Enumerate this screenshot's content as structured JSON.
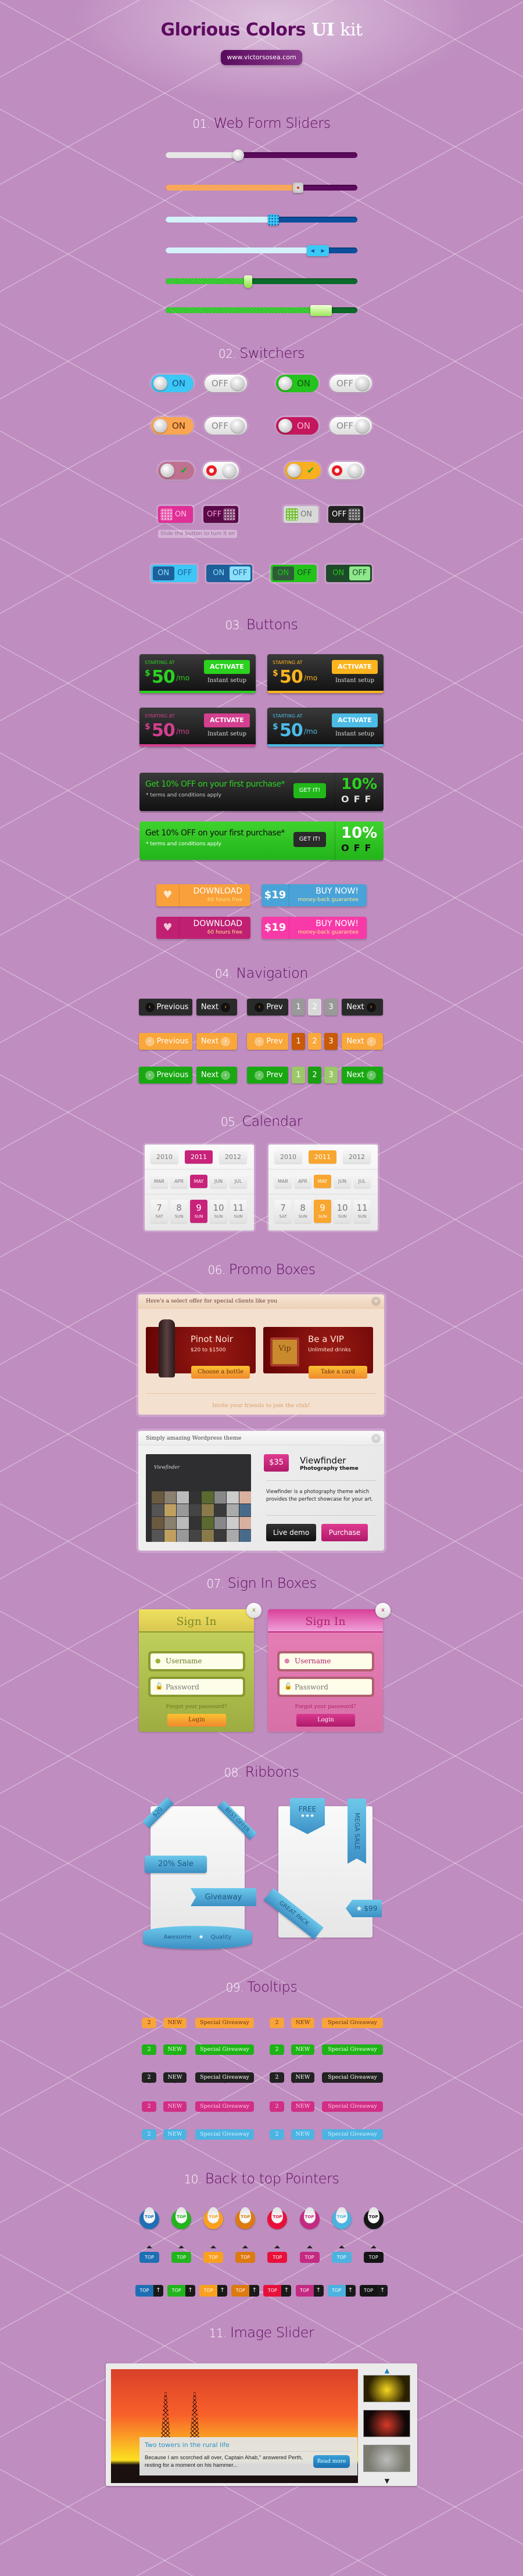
{
  "header": {
    "title_a": "Glorious Colors",
    "title_b": "UI",
    "title_c": "kit",
    "url": "www.victorsosea.com"
  },
  "sections": [
    {
      "num": "01.",
      "title": "Web Form Sliders"
    },
    {
      "num": "02.",
      "title": "Switchers"
    },
    {
      "num": "03.",
      "title": "Buttons"
    },
    {
      "num": "04.",
      "title": "Navigation"
    },
    {
      "num": "05.",
      "title": "Calendar"
    },
    {
      "num": "06.",
      "title": "Promo Boxes"
    },
    {
      "num": "07.",
      "title": "Sign In Boxes"
    },
    {
      "num": "08.",
      "title": "Ribbons"
    },
    {
      "num": "09.",
      "title": "Tooltips"
    },
    {
      "num": "10.",
      "title": "Back to top Pointers"
    },
    {
      "num": "11.",
      "title": "Image Slider"
    }
  ],
  "sliders": [
    {
      "value": 0.38,
      "fill": "#e4e4e4",
      "track": "#5c0a5c",
      "thumb": "round-knob"
    },
    {
      "value": 0.69,
      "fill": "#f7a04e",
      "track": "#5c0a5c",
      "thumb": "square-knob"
    },
    {
      "value": 0.56,
      "fill": "#d2f0fb",
      "track": "#0b4f9e",
      "thumb": "grip-square"
    },
    {
      "value": 0.79,
      "fill": "#d2f0fb",
      "track": "#0b4f9e",
      "thumb": "arrows"
    },
    {
      "value": 0.43,
      "fill": "#2cc425",
      "track": "#0a6a2a",
      "thumb": "pointer"
    },
    {
      "value": 0.79,
      "fill": "#2cc425",
      "track": "#0a6a2a",
      "thumb": "grip-bar"
    }
  ],
  "switchers": {
    "round": [
      [
        {
          "label": "ON",
          "on": true,
          "color": "#3cc7f6",
          "text": "#14508a"
        },
        {
          "label": "OFF",
          "on": false
        },
        {
          "label": "ON",
          "on": true,
          "color": "#25c31d",
          "text": "#0d5a10"
        },
        {
          "label": "OFF",
          "on": false
        }
      ],
      [
        {
          "label": "ON",
          "on": true,
          "color": "#fba652",
          "text": "#5a2a08"
        },
        {
          "label": "OFF",
          "on": false
        },
        {
          "label": "ON",
          "on": true,
          "color": "#c4175d",
          "text": "#ffb0d0"
        },
        {
          "label": "OFF",
          "on": false
        }
      ]
    ],
    "icons": [
      {
        "on": true,
        "color": "#c07090",
        "icon": "check-icon"
      },
      {
        "on": false,
        "icon": "stop-icon"
      },
      {
        "on": true,
        "color": "#f8b020",
        "icon": "check-icon"
      },
      {
        "on": false,
        "icon": "stop-icon"
      }
    ],
    "square": [
      {
        "label": "ON",
        "on": true,
        "color": "#e02f97",
        "text": "#ffc0e6"
      },
      {
        "label": "OFF",
        "on": false,
        "color": "#5a0848",
        "text": "#ff9ad8"
      },
      {
        "label": "ON",
        "on": true,
        "color": "#d8d8d8",
        "text": "#777"
      },
      {
        "label": "OFF",
        "on": false,
        "color": "#222",
        "text": "#fff"
      }
    ],
    "hint": "Slide the button to turn it on",
    "segmented": [
      {
        "on": "ON",
        "off": "OFF",
        "active": "ON",
        "color": "#3cc7f6",
        "dark": "#1d5f9a"
      },
      {
        "on": "ON",
        "off": "OFF",
        "active": "OFF",
        "color": "#1d5f9a",
        "dark": "#8ae0fb"
      },
      {
        "on": "ON",
        "off": "OFF",
        "active": "ON",
        "color": "#22c41a",
        "dark": "#1f5a2e"
      },
      {
        "on": "ON",
        "off": "OFF",
        "active": "OFF",
        "color": "#1f4a2a",
        "dark": "#8ee88a"
      }
    ]
  },
  "pricing": [
    {
      "starting": "STARTING AT",
      "currency": "$",
      "price": "50",
      "per": "/mo",
      "action": "ACTIVATE",
      "note": "Instant setup",
      "accent": "#2bd21f"
    },
    {
      "starting": "STARTING AT",
      "currency": "$",
      "price": "50",
      "per": "/mo",
      "action": "ACTIVATE",
      "note": "Instant setup",
      "accent": "#fbb41e"
    },
    {
      "starting": "STARTING AT",
      "currency": "$",
      "price": "50",
      "per": "/mo",
      "action": "ACTIVATE",
      "note": "Instant setup",
      "accent": "#d43f8f"
    },
    {
      "starting": "STARTING AT",
      "currency": "$",
      "price": "50",
      "per": "/mo",
      "action": "ACTIVATE",
      "note": "Instant setup",
      "accent": "#4cbbe6"
    }
  ],
  "promo_bars": [
    {
      "headline": "Get 10% OFF on your first purchase*",
      "terms": "* terms and conditions apply",
      "button": "GET IT!",
      "big": "10%",
      "off": "OFF",
      "theme": "dark"
    },
    {
      "headline": "Get 10% OFF on your first purchase*",
      "terms": "* terms and conditions apply",
      "button": "GET IT!",
      "big": "10%",
      "off": "OFF",
      "theme": "green"
    }
  ],
  "download_buttons": [
    {
      "main": "DOWNLOAD",
      "sub": "60 hours free",
      "color": "#f9a03a"
    },
    {
      "main": "DOWNLOAD",
      "sub": "60 hours free",
      "color": "#c01f72"
    }
  ],
  "buy_buttons": [
    {
      "price": "$19",
      "main": "BUY NOW!",
      "sub": "money-back guarantee",
      "color": "#4aa3d8"
    },
    {
      "price": "$19",
      "main": "BUY NOW!",
      "sub": "money-back guarantee",
      "color": "#f83aa8"
    }
  ],
  "navigation": {
    "previous": "Previous",
    "next": "Next",
    "prev": "Prev",
    "pages": [
      "1",
      "2",
      "3"
    ],
    "active_page": "2",
    "themes": [
      {
        "bg": "#2a2a2a",
        "page": "#999",
        "active": "#d8d8d8",
        "text": "#fff",
        "circle": "#111",
        "arrow": "#f8a020"
      },
      {
        "bg": "#f9a63a",
        "page": "#c85a08",
        "active": "#fba83c",
        "text": "#fff",
        "circle": "rgba(255,255,255,.35)",
        "arrow": "#fff"
      },
      {
        "bg": "#19a812",
        "page": "#9cc86a",
        "active": "#18a010",
        "text": "#fff",
        "circle": "rgba(255,255,255,.35)",
        "arrow": "#fff"
      }
    ]
  },
  "calendars": [
    {
      "accent": "#c8237a",
      "years": [
        "2010",
        "2011",
        "2012"
      ],
      "selected_year": "2011",
      "months": [
        "MAR",
        "APR",
        "MAY",
        "JUN",
        "JUL"
      ],
      "selected_month": "MAY",
      "days": [
        {
          "n": "7",
          "d": "SAT"
        },
        {
          "n": "8",
          "d": "SUN"
        },
        {
          "n": "9",
          "d": "SUN"
        },
        {
          "n": "10",
          "d": "SUN"
        },
        {
          "n": "11",
          "d": "SUN"
        }
      ],
      "selected_day": "9"
    },
    {
      "accent": "#f8a630",
      "years": [
        "2010",
        "2011",
        "2012"
      ],
      "selected_year": "2011",
      "months": [
        "MAR",
        "APR",
        "MAY",
        "JUN",
        "JUL"
      ],
      "selected_month": "MAY",
      "days": [
        {
          "n": "7",
          "d": "SAT"
        },
        {
          "n": "8",
          "d": "SUN"
        },
        {
          "n": "9",
          "d": "SUN"
        },
        {
          "n": "10",
          "d": "SUN"
        },
        {
          "n": "11",
          "d": "SUN"
        }
      ],
      "selected_day": "9"
    }
  ],
  "promo_wine": {
    "header": "Here's a select offer for special clients like you",
    "close": "x",
    "offers": [
      {
        "title": "Pinot Noir",
        "sub": "$20 to $1500",
        "button": "Choose a bottle"
      },
      {
        "title": "Be a VIP",
        "sub": "Unlimited drinks",
        "button": "Take a card",
        "tag": "Vip"
      }
    ],
    "footer": "Invite your friends to join the club!"
  },
  "promo_theme": {
    "header": "Simply amazing Wordpress theme",
    "close": "x",
    "preview_logo": "Viewfinder",
    "price": "$35",
    "name": "Viewfinder",
    "subtitle": "Photography theme",
    "description": "Viewfinder is a photography theme which provides the perfect showcase for your art.",
    "demo": "Live demo",
    "purchase": "Purchase"
  },
  "signin": [
    {
      "title": "Sign In",
      "username": "Username",
      "password": "Password",
      "forgot": "Forgot your password?",
      "login": "Login",
      "close": "x",
      "theme": "green"
    },
    {
      "title": "Sign In",
      "username": "Username",
      "password": "Password",
      "forgot": "Forgot your password?",
      "login": "Login",
      "close": "x",
      "theme": "pink"
    }
  ],
  "ribbons": {
    "corner_price": "$20",
    "corner_offer": "BEST OFFER",
    "sale": "20% Sale",
    "giveaway": "Giveaway",
    "banner_left": "Awesome",
    "banner_right": "Quality",
    "free": "FREE",
    "mega": "MEGA SALE",
    "pack": "GREAT PACK",
    "tag_price": "$99"
  },
  "tooltips": {
    "labels": [
      "2",
      "NEW",
      "Special Giveaway"
    ],
    "rows": [
      {
        "bg": "#f9a43a",
        "text": "#6a3410"
      },
      {
        "bg": "#1fb318",
        "text": "#e8ffe0"
      },
      {
        "bg": "#222",
        "text": "#fff"
      },
      {
        "bg": "#d12e85",
        "text": "#ffc6e4"
      },
      {
        "bg": "#4cb3e2",
        "text": "#d0f2ff"
      }
    ]
  },
  "top_pointers": {
    "label": "TOP",
    "colors": [
      "#1f6fb5",
      "#22b51e",
      "#f9a020",
      "#dd7a10",
      "#e8103a",
      "#c42a82",
      "#4cb2e0",
      "#151515"
    ]
  },
  "image_slider": {
    "caption_title": "Two towers in the rural life",
    "caption_text": "Because I am scorched all over, Captain Ahab,\" answered Perth, resting for a moment on his hammer...",
    "read_more": "Read more"
  }
}
